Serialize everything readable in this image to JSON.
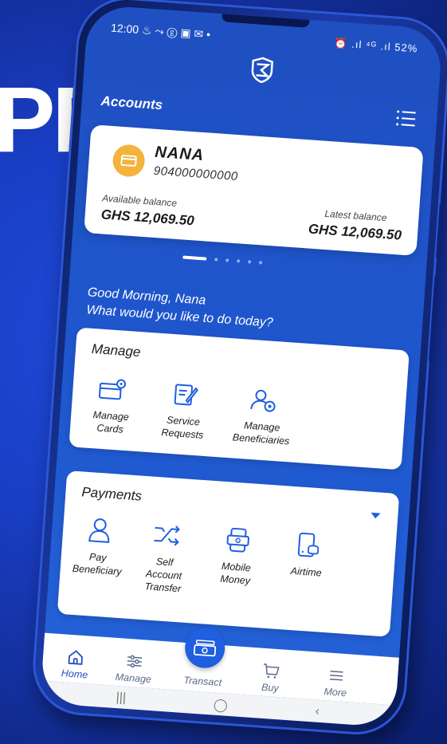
{
  "background_text": "PP",
  "status_bar": {
    "time": "12:00",
    "left_icons": "♨ ⤳ ⓖ ▣ ✉ •",
    "right_icons": "⏰ .ıl ⁴ᴳ .ıl",
    "battery": "52%"
  },
  "header": {
    "title": "Accounts"
  },
  "account_card": {
    "name": "NANA",
    "number": "904000000000",
    "available_label": "Available balance",
    "available_value": "GHS 12,069.50",
    "latest_label": "Latest balance",
    "latest_value": "GHS 12,069.50"
  },
  "carousel": {
    "count": 6,
    "active_index": 0
  },
  "greeting": {
    "line1": "Good Morning, Nana",
    "line2": "What would you like to do today?"
  },
  "manage": {
    "title": "Manage",
    "items": [
      {
        "line1": "Manage",
        "line2": "Cards",
        "icon": "card-settings-icon"
      },
      {
        "line1": "Service",
        "line2": "Requests",
        "icon": "edit-document-icon"
      },
      {
        "line1": "Manage",
        "line2": "Beneficiaries",
        "icon": "user-settings-icon"
      }
    ]
  },
  "payments": {
    "title": "Payments",
    "items": [
      {
        "line1": "Pay",
        "line2": "Beneficiary",
        "line3": "",
        "icon": "user-icon"
      },
      {
        "line1": "Self",
        "line2": "Account",
        "line3": "Transfer",
        "icon": "transfer-arrows-icon"
      },
      {
        "line1": "Mobile",
        "line2": "Money",
        "line3": "",
        "icon": "mobile-money-icon"
      },
      {
        "line1": "Airtime",
        "line2": "",
        "line3": "",
        "icon": "airtime-icon"
      }
    ]
  },
  "bottom_nav": {
    "home": "Home",
    "manage": "Manage",
    "transact": "Transact",
    "buy": "Buy",
    "more": "More"
  },
  "system_nav": {
    "recent": "|||",
    "home": "◯",
    "back": "‹"
  },
  "colors": {
    "brand_blue": "#1f4fc0",
    "accent_blue": "#1f5fe0",
    "card_icon": "#f4b33a"
  }
}
